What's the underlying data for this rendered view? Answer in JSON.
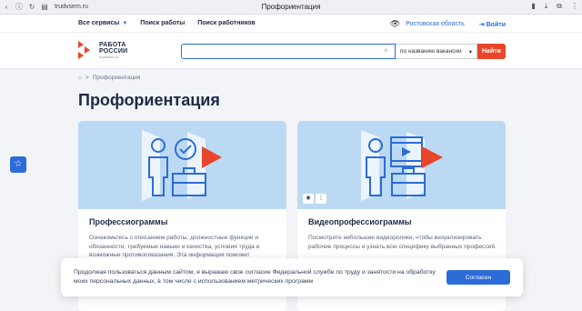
{
  "browser": {
    "url": "trudvsem.ru",
    "tab_title": "Профориентация"
  },
  "top_nav": {
    "items": [
      {
        "label": "Все сервисы"
      },
      {
        "label": "Поиск работы"
      },
      {
        "label": "Поиск работников"
      }
    ],
    "region": "Ростовская область",
    "login": "Войти"
  },
  "header": {
    "logo_line1": "РАБОТА",
    "logo_line2": "РОССИИ",
    "logo_sub": "trudvsem.ru",
    "search_placeholder": "",
    "search_mode": "по названию вакансии",
    "search_button": "Найти"
  },
  "breadcrumb": {
    "current": "Профориентация",
    "separator": ">"
  },
  "page_title": "Профориентация",
  "cards": [
    {
      "title": "Профессиограммы",
      "text": "Ознакомьтесь с описанием работы: должностные функции и обязанности, требуемые навыки и качества, условия труда и возможные противопоказания. Эта информация поможет"
    },
    {
      "title": "Видеопрофессиограммы",
      "text": "Посмотрите небольшие видеоролики, чтобы визуализировать рабочие процессы и узнать всю специфику выбранных профессий."
    }
  ],
  "cookie": {
    "text": "Продолжая пользоваться данным сайтом, я выражаю свое согласие Федеральной службе по труду и занятости на обработку моих персональных данных, в том числе с использованием метрических программ",
    "button": "Согласен"
  },
  "colors": {
    "accent_blue": "#2b6cd8",
    "accent_red": "#e8452b",
    "card_image_bg": "#bcd9f3",
    "text_dark": "#1f2a44"
  }
}
